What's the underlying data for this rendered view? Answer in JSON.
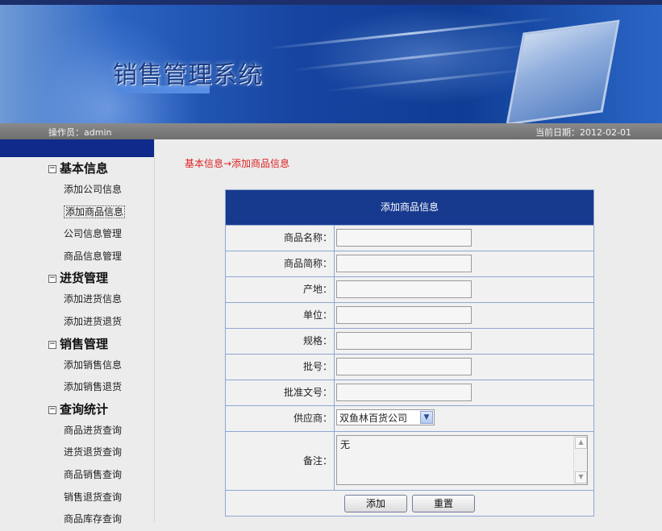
{
  "header": {
    "system_title": "销售管理系统",
    "operator": "操作员：admin",
    "current_date": "当前日期：2012-02-01"
  },
  "sidebar": {
    "groups": [
      {
        "title": "基本信息",
        "items": [
          "添加公司信息",
          "添加商品信息",
          "公司信息管理",
          "商品信息管理"
        ]
      },
      {
        "title": "进货管理",
        "items": [
          "添加进货信息",
          "添加进货退货"
        ]
      },
      {
        "title": "销售管理",
        "items": [
          "添加销售信息",
          "添加销售退货"
        ]
      },
      {
        "title": "查询统计",
        "items": [
          "商品进货查询",
          "进货退货查询",
          "商品销售查询",
          "销售退货查询",
          "商品库存查询"
        ]
      }
    ],
    "active_item": "添加商品信息"
  },
  "breadcrumb": "基本信息→添加商品信息",
  "form": {
    "title": "添加商品信息",
    "fields": [
      {
        "label": "商品名称：",
        "value": ""
      },
      {
        "label": "商品简称：",
        "value": ""
      },
      {
        "label": "产地：",
        "value": ""
      },
      {
        "label": "单位：",
        "value": ""
      },
      {
        "label": "规格：",
        "value": ""
      },
      {
        "label": "批号：",
        "value": ""
      },
      {
        "label": "批准文号：",
        "value": ""
      }
    ],
    "supplier": {
      "label": "供应商：",
      "selected": "双鱼林百货公司"
    },
    "remark": {
      "label": "备注：",
      "value": "无"
    },
    "buttons": {
      "add": "添加",
      "reset": "重置"
    }
  },
  "colors": {
    "nav_header": "#0f2a8a",
    "form_header": "#173a8f",
    "breadcrumb": "#dd2222",
    "table_border": "#8fa6d1"
  }
}
